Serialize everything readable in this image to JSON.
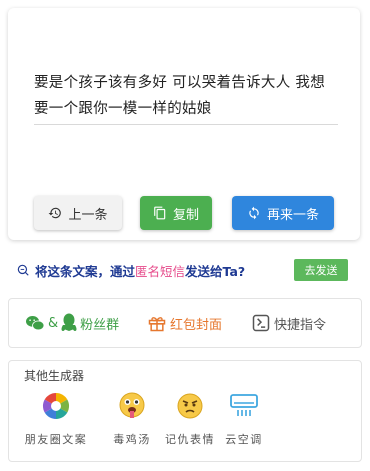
{
  "main": {
    "quote": "要是个孩子该有多好 可以哭着告诉大人 我想要一个跟你一模一样的姑娘",
    "buttons": {
      "prev": "上一条",
      "copy": "复制",
      "again": "再来一条"
    }
  },
  "send": {
    "prefix": "将这条文案，通过",
    "highlight": "匿名短信",
    "suffix": "发送给Ta?",
    "button": "去发送"
  },
  "links": {
    "fans_sep": "&",
    "fans": "粉丝群",
    "red_packet": "红包封面",
    "shortcut": "快捷指令"
  },
  "generators": {
    "title": "其他生成器",
    "items": [
      {
        "label": "朋友圈文案",
        "icon": "camera-aperture-icon"
      },
      {
        "label": "毒鸡汤",
        "icon": "drooling-face-icon"
      },
      {
        "label": "记仇表情",
        "icon": "angry-face-icon"
      },
      {
        "label": "云空调",
        "icon": "air-conditioner-icon"
      }
    ]
  }
}
